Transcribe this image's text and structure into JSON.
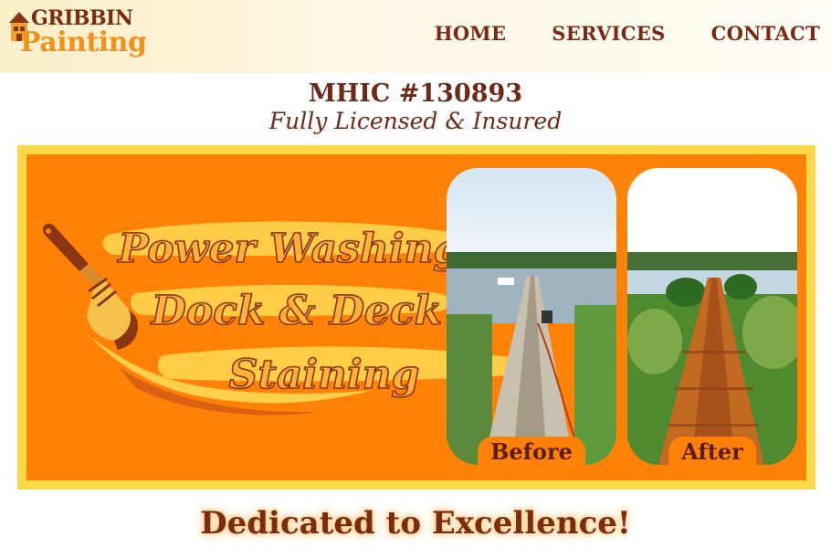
{
  "header": {
    "logo": {
      "top": "GRIBBIN",
      "bottom": "Painting"
    },
    "nav": [
      {
        "label": "HOME"
      },
      {
        "label": "SERVICES"
      },
      {
        "label": "CONTACT"
      }
    ]
  },
  "license": {
    "number": "MHIC #130893",
    "tagline": "Fully Licensed & Insured"
  },
  "banner": {
    "headline_lines": [
      "Power Washing,",
      "Dock & Deck",
      "Staining"
    ],
    "before_label": "Before",
    "after_label": "After"
  },
  "footer": {
    "heading": "Dedicated to Excellence!"
  },
  "colors": {
    "banner_orange": "#ff8106",
    "banner_border": "#fbd848",
    "text_brown": "#7a2b10",
    "logo_orange": "#f2901c"
  },
  "icons": [
    "house-icon",
    "paintbrush-icon"
  ]
}
